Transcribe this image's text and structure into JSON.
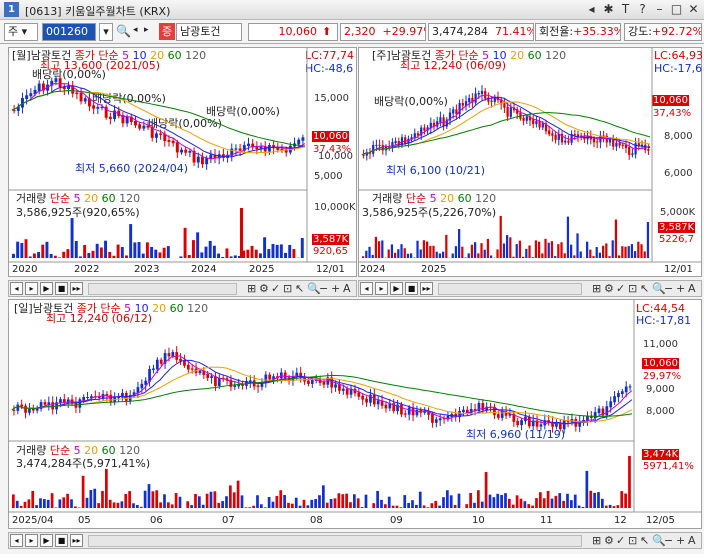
{
  "window": {
    "number": "1",
    "title": "[0613] 키움일주월차트 (KRX)"
  },
  "toolbar": {
    "market": "주",
    "code": "001260",
    "stock_name": "남광토건",
    "badge": "증",
    "price": "10,060",
    "change": "2,320",
    "change_pct": "+29.97%",
    "volume": "3,474,284",
    "vol_ratio": "71.41%",
    "turnover_label": "회전율:",
    "turnover": "+35.33%",
    "strength_label": "강도:",
    "strength": "+92.72%"
  },
  "daily_panel": {
    "title": "[월]남광토건",
    "ma_label": "종가 단순",
    "ma_periods": [
      "5",
      "10",
      "20",
      "60",
      "120"
    ],
    "lc": "LC:77,74",
    "hc": "HC:-48,6",
    "y_ticks": [
      "15,000",
      "10,000",
      "5,000"
    ],
    "price_tag": "10,060",
    "pct_tag": "37,43%",
    "high_label": "최고 13,600 (2021/05)",
    "low_label": "최저 5,660 (2024/04)",
    "dividends": [
      "배당락(0,00%)",
      "배당락(0,00%)",
      "배당락(0,00%)",
      "배당락(0,00%)"
    ],
    "vol_title": "거래량",
    "vol_ma": "단순",
    "vol_periods": [
      "5",
      "20",
      "60",
      "120"
    ],
    "vol_text": "3,586,925주(920,65%)",
    "vol_ticks": [
      "10,000K"
    ],
    "vol_tag": "3,587K",
    "vol_pct_tag": "920,65",
    "x_labels": [
      "2020",
      "2022",
      "2023",
      "2024",
      "2025",
      "12/01"
    ]
  },
  "weekly_panel": {
    "title": "[주]남광토건",
    "ma_label": "종가 단순",
    "ma_periods": [
      "5",
      "10",
      "20",
      "60",
      "120"
    ],
    "lc": "LC:64,93",
    "hc": "HC:-17,6",
    "y_ticks": [
      "8,000",
      "6,000"
    ],
    "price_tag": "10,060",
    "pct_tag": "37,43%",
    "high_label": "최고 12,240 (06/09)",
    "low_label": "최저 6,100 (10/21)",
    "dividend": "배당락(0,00%)",
    "vol_title": "거래량",
    "vol_ma": "단순",
    "vol_periods": [
      "5",
      "20",
      "60",
      "120"
    ],
    "vol_text": "3,586,925주(5,226,70%)",
    "vol_ticks": [
      "5,000K"
    ],
    "vol_tag": "3,587K",
    "vol_pct_tag": "5226,7",
    "x_labels": [
      "2024",
      "2025",
      "12/01"
    ]
  },
  "main_panel": {
    "title": "[일]남광토건",
    "ma_label": "종가 단순",
    "ma_periods": [
      "5",
      "10",
      "20",
      "60",
      "120"
    ],
    "lc": "LC:44,54",
    "hc": "HC:-17,81",
    "y_ticks": [
      "11,000",
      "9,000",
      "8,000"
    ],
    "price_tag": "10,060",
    "pct_tag": "29,97%",
    "high_label": "최고 12,240 (06/12)",
    "low_label": "최저 6,960 (11/19)",
    "vol_title": "거래량",
    "vol_ma": "단순",
    "vol_periods": [
      "5",
      "20",
      "60",
      "120"
    ],
    "vol_text": "3,474,284주(5,971,41%)",
    "vol_tag": "3,474K",
    "vol_pct_tag": "5971,41%",
    "x_labels": [
      "2025/04",
      "05",
      "06",
      "07",
      "08",
      "09",
      "10",
      "11",
      "12",
      "12/05"
    ]
  },
  "colors": {
    "up": "#e00000",
    "down": "#1030d0",
    "ma5": "#d000d0",
    "ma10": "#2020f0",
    "ma20": "#f0a000",
    "ma60": "#008000",
    "ma120": "#606060"
  }
}
